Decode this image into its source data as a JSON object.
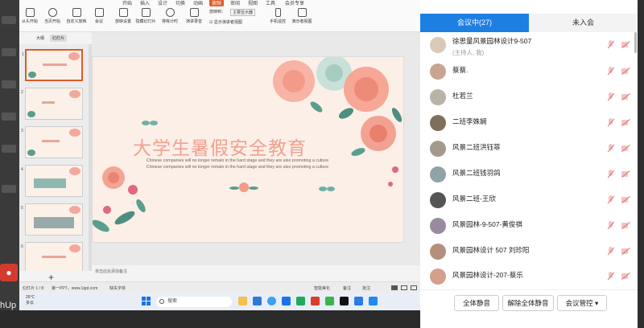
{
  "ribbon": {
    "tabs": [
      "开始",
      "插入",
      "设计",
      "切换",
      "动画",
      "放映",
      "审阅",
      "视图",
      "工具",
      "会员专享"
    ],
    "buttons": [
      "从头开始",
      "当页开始",
      "自定义放映",
      "会议",
      "放映设置",
      "隐藏幻灯片",
      "排练计时",
      "演讲录音",
      "手机遥控",
      "演示者视图"
    ],
    "options": [
      "放映到：",
      "主要显示器",
      "显示演讲者视图"
    ]
  },
  "panel_tabs": [
    "大纲",
    "幻灯片"
  ],
  "slide": {
    "title": "大学生暑假安全教育",
    "body": "Chinese companies will no longer remain in the hard stage and they are also promoting a culture Chinese companies will no longer remain in the hard stage and they are also promoting a culture"
  },
  "notes_placeholder": "单击此处添加备注",
  "status": {
    "slide_count": "幻灯片 1 / 8",
    "template": "第一PPT，www.1ppt.com",
    "font_missing": "缺失字体",
    "smart_beautify": "智能美化",
    "notes": "备注",
    "comments": "批注"
  },
  "taskbar": {
    "weather_temp": "26°C",
    "weather_desc": "多云",
    "search": "搜索"
  },
  "desktop_left": [
    "hUp",
    "20"
  ],
  "meeting": {
    "tabs": [
      "会议中(27)",
      "未入会"
    ],
    "members": [
      {
        "name": "徐思量风景园林设计9-507",
        "sub": "(主持人, 我)",
        "color": "#d9c9b8"
      },
      {
        "name": "蔡蔡.",
        "sub": "",
        "color": "#c8a58f"
      },
      {
        "name": "杜若兰",
        "sub": "",
        "color": "#b9b3a6"
      },
      {
        "name": "二班李姝娴",
        "sub": "",
        "color": "#7f6f5c"
      },
      {
        "name": "风景二班洪钰菲",
        "sub": "",
        "color": "#a29a8c"
      },
      {
        "name": "风景二班钱羽鸽",
        "sub": "",
        "color": "#8fa3a8"
      },
      {
        "name": "风景二班-王欣",
        "sub": "",
        "color": "#555555"
      },
      {
        "name": "风景园林-9-507-黄俊祺",
        "sub": "",
        "color": "#9a8aa0"
      },
      {
        "name": "风景园林设计 507 刘珍阳",
        "sub": "",
        "color": "#b48f7c"
      },
      {
        "name": "风景园林设计-207-蔡乐",
        "sub": "",
        "color": "#d4a08a"
      }
    ],
    "footer": {
      "mute_all": "全体静音",
      "unmute_all": "解除全体静音",
      "manage": "会议管控 ▾"
    }
  },
  "colors": {
    "accent": "#1e7fe3",
    "wps_orange": "#e05a2b",
    "title_pink": "#f0a190"
  }
}
